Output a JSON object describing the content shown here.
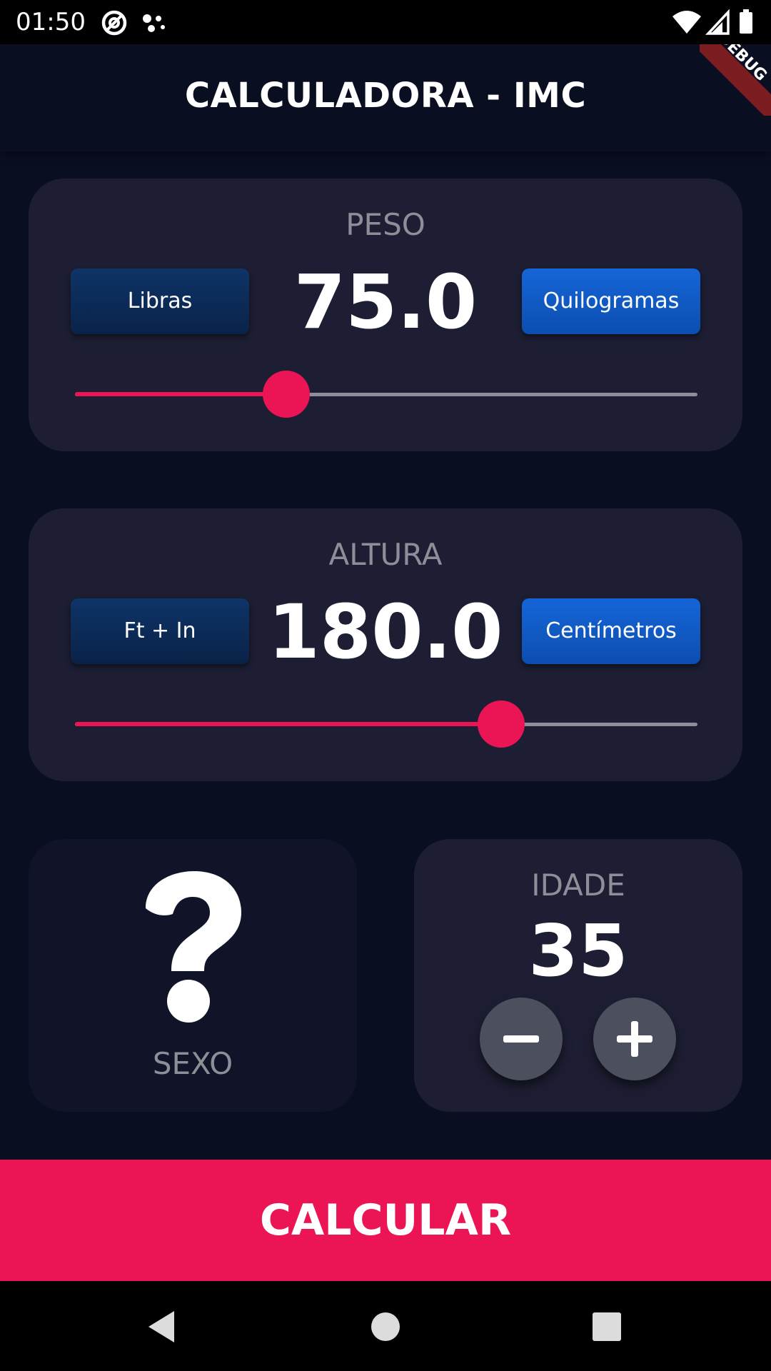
{
  "status_bar": {
    "time": "01:50"
  },
  "app_bar": {
    "title": "CALCULADORA - IMC",
    "debug_banner": "DEBUG"
  },
  "peso": {
    "label": "PESO",
    "value": "75.0",
    "unit_left": "Libras",
    "unit_right": "Quilogramas",
    "selected_unit": "Quilogramas",
    "slider_fraction": 0.34
  },
  "altura": {
    "label": "ALTURA",
    "value": "180.0",
    "unit_left": "Ft + In",
    "unit_right": "Centímetros",
    "selected_unit": "Centímetros",
    "slider_fraction": 0.685
  },
  "sexo": {
    "label": "SEXO",
    "icon": "question-mark-icon"
  },
  "idade": {
    "label": "IDADE",
    "value": "35",
    "decrement_icon": "minus-icon",
    "increment_icon": "plus-icon"
  },
  "calcular": {
    "label": "CALCULAR"
  },
  "colors": {
    "background": "#0a0e21",
    "card": "#1d1e33",
    "accent": "#eb1555",
    "label": "#8d8e98",
    "unit_active": "#1565d8",
    "unit_inactive": "#0e3468",
    "round_button": "#4c4f5e"
  }
}
